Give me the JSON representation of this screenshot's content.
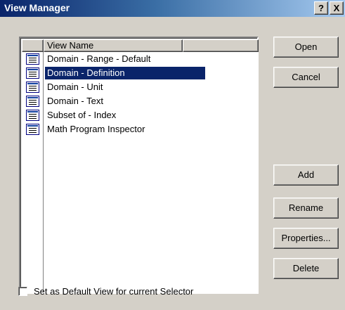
{
  "window": {
    "title": "View Manager",
    "help_glyph": "?",
    "close_glyph": "X"
  },
  "list": {
    "columns": [
      "",
      "View Name",
      ""
    ],
    "items": [
      {
        "label": "Domain - Range - Default",
        "selected": false
      },
      {
        "label": "Domain - Definition",
        "selected": true
      },
      {
        "label": "Domain - Unit",
        "selected": false
      },
      {
        "label": "Domain - Text",
        "selected": false
      },
      {
        "label": "Subset of - Index",
        "selected": false
      },
      {
        "label": "Math Program Inspector",
        "selected": false
      }
    ]
  },
  "buttons": {
    "open": "Open",
    "cancel": "Cancel",
    "add": "Add",
    "rename": "Rename",
    "properties": "Properties...",
    "delete": "Delete"
  },
  "checkbox": {
    "label": "Set as Default View for current Selector",
    "checked": false
  },
  "colors": {
    "selection": "#0a246a",
    "face": "#d4d0c8",
    "title_start": "#0a246a",
    "title_end": "#a6caf0"
  }
}
